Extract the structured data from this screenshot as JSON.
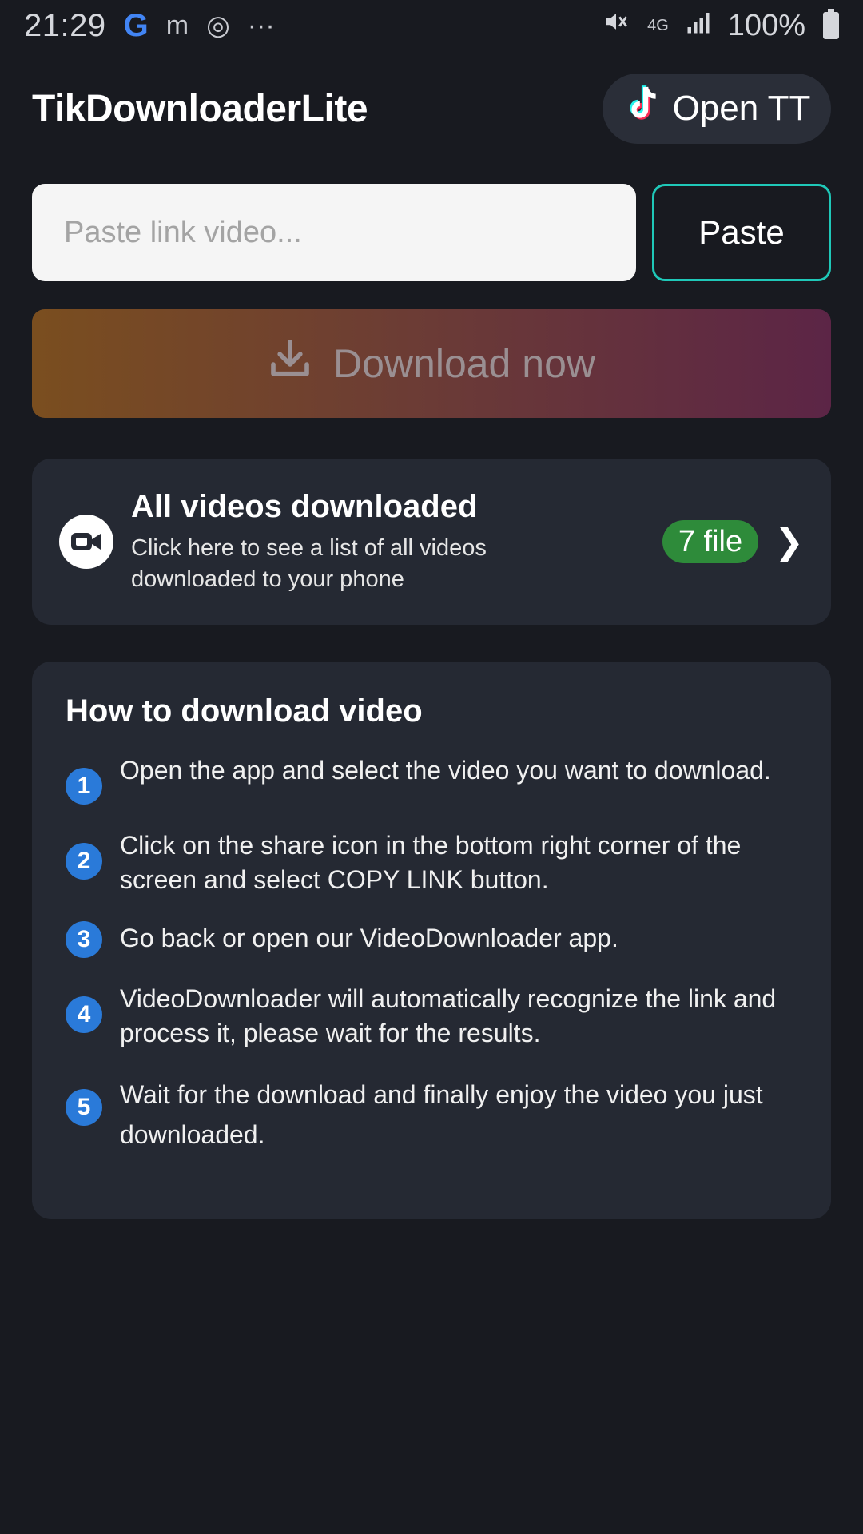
{
  "status_bar": {
    "time": "21:29",
    "battery_text": "100%",
    "network": "4G"
  },
  "header": {
    "app_title": "TikDownloaderLite",
    "open_tt_label": "Open TT"
  },
  "input": {
    "placeholder": "Paste link video...",
    "value": "",
    "paste_label": "Paste"
  },
  "download": {
    "label": "Download now"
  },
  "videos_card": {
    "title": "All videos downloaded",
    "subtitle": "Click here to see a list of all videos downloaded to your phone",
    "file_count": "7 file"
  },
  "howto": {
    "title": "How to download video",
    "steps": [
      {
        "num": "1",
        "text": "Open the app and select the video you want to download."
      },
      {
        "num": "2",
        "text": "Click on the share icon in the bottom right corner of the screen and select COPY LINK button."
      },
      {
        "num": "3",
        "text": "Go back or open our VideoDownloader app."
      },
      {
        "num": "4",
        "text": "VideoDownloader will automatically recognize the link and process it, please wait for the results."
      },
      {
        "num": "5",
        "text": "Wait for the download and finally enjoy the video you just downloaded."
      }
    ]
  },
  "colors": {
    "background": "#181a20",
    "card": "#252933",
    "accent_teal": "#1fc8b8",
    "badge_green": "#2e8b3a",
    "step_blue": "#2a7ad9"
  }
}
